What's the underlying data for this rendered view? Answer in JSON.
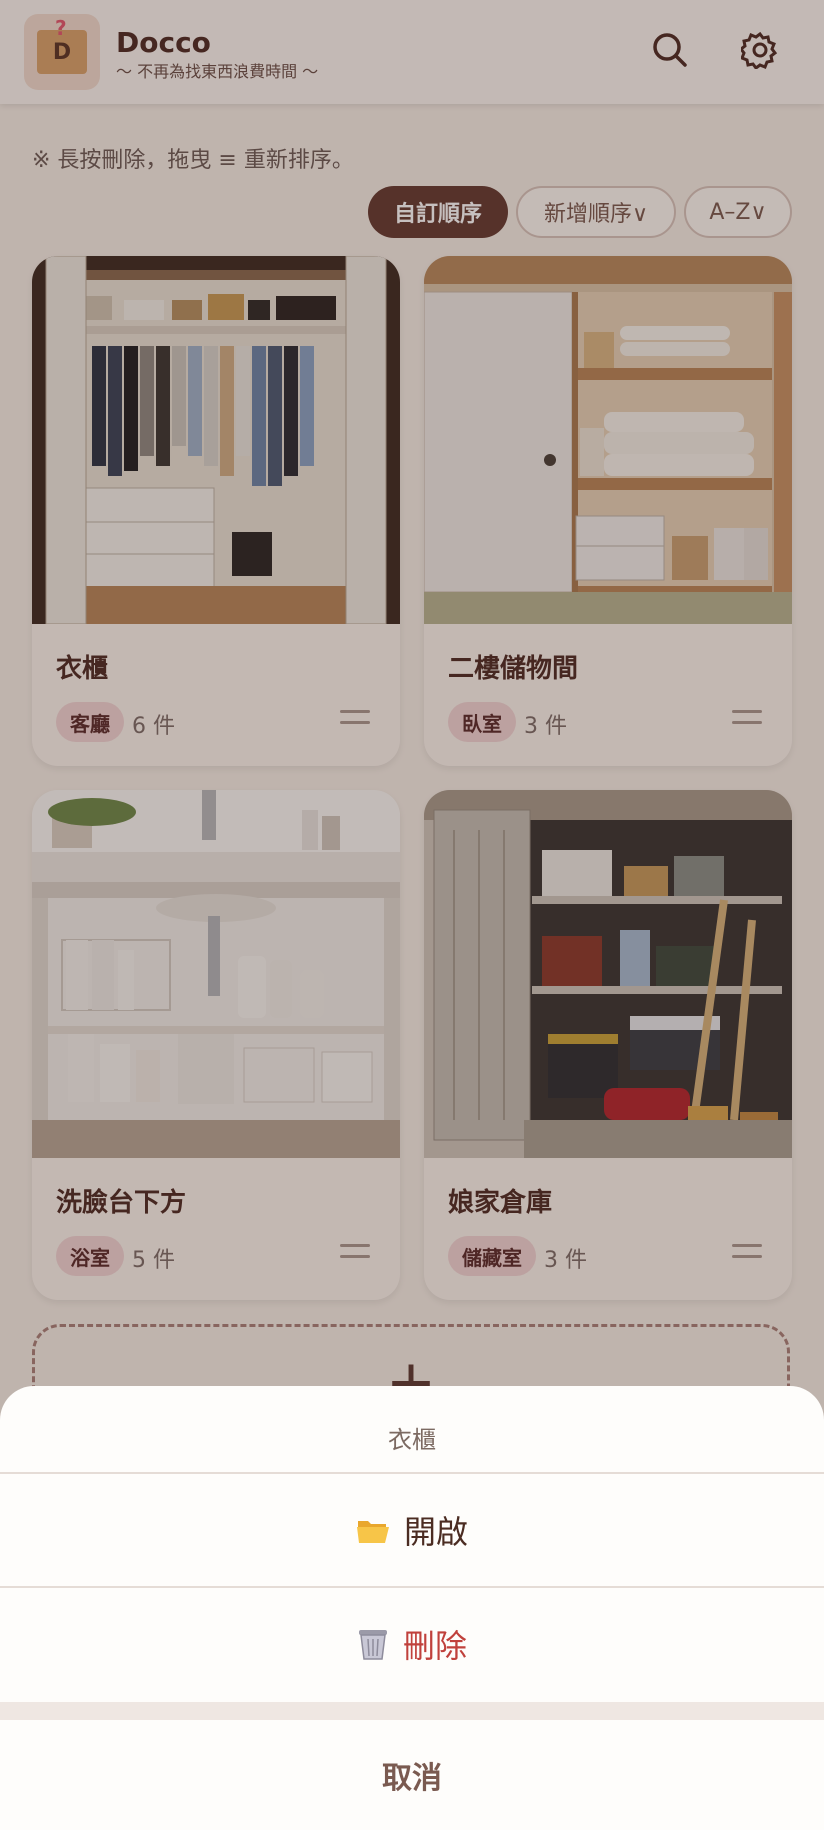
{
  "header": {
    "app_name": "Docco",
    "tagline": "〜 不再為找東西浪費時間 〜",
    "icons": [
      "search-icon",
      "gear-icon"
    ]
  },
  "hint": "※ 長按刪除，拖曳 ≡ 重新排序。",
  "sort": {
    "options": [
      "自訂順序",
      "新增順序∨",
      "A–Z∨"
    ],
    "active": "自訂順序"
  },
  "storages": [
    {
      "name": "衣櫃",
      "room": "客廳",
      "count": "6 件"
    },
    {
      "name": "二樓儲物間",
      "room": "臥室",
      "count": "3 件"
    },
    {
      "name": "洗臉台下方",
      "room": "浴室",
      "count": "5 件"
    },
    {
      "name": "娘家倉庫",
      "room": "儲藏室",
      "count": "3 件"
    }
  ],
  "add_symbol": "+",
  "sheet": {
    "title": "衣櫃",
    "open_label": "開啟",
    "delete_label": "刪除",
    "cancel_label": "取消",
    "icons": [
      "folder-icon",
      "trash-icon"
    ]
  },
  "colors": {
    "accent": "#643b31",
    "delete": "#c0413c",
    "tag_bg": "#f2d5d4"
  }
}
